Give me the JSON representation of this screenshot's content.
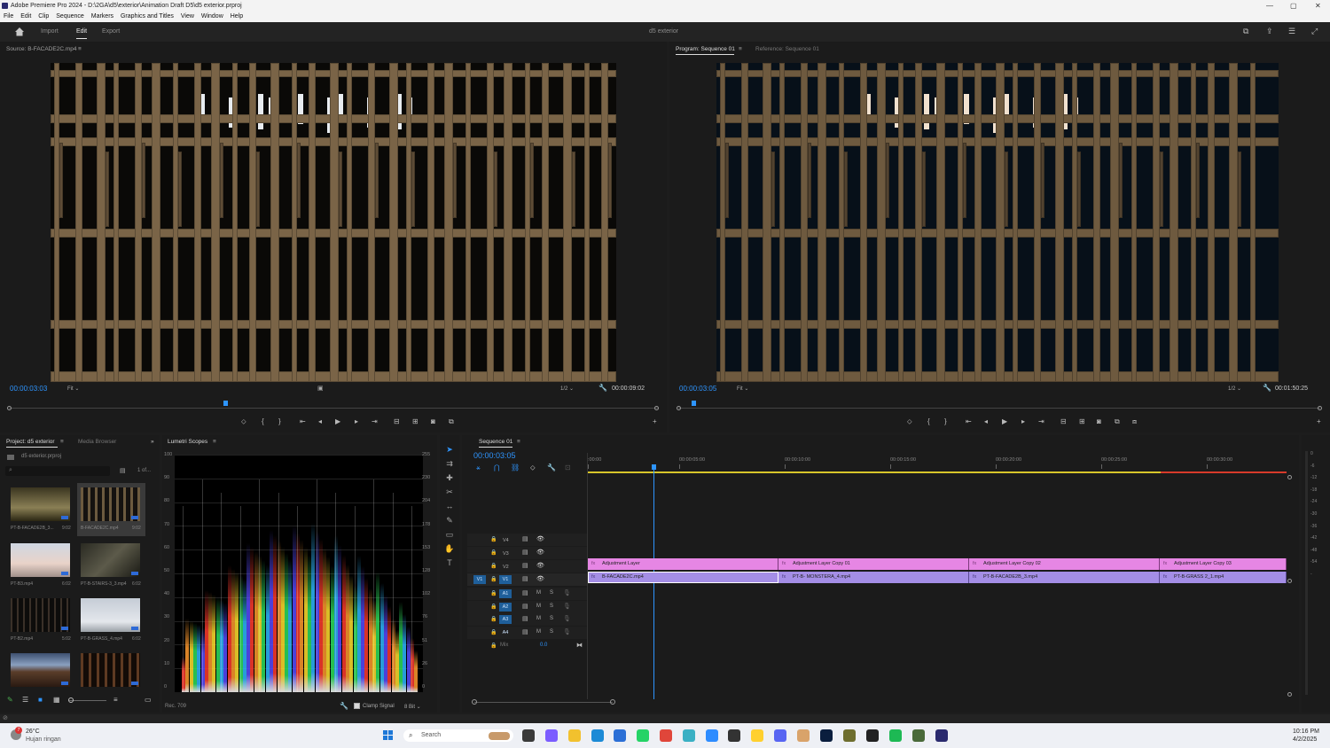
{
  "titlebar": {
    "title": "Adobe Premiere Pro 2024 - D:\\2GA\\d5\\exterior\\Animation Draft D5\\d5 exterior.prproj"
  },
  "menu": [
    "File",
    "Edit",
    "Clip",
    "Sequence",
    "Markers",
    "Graphics and Titles",
    "View",
    "Window",
    "Help"
  ],
  "workspace": {
    "tabs": [
      "Import",
      "Edit",
      "Export"
    ],
    "active": "Edit",
    "project_name": "d5 exterior"
  },
  "source_monitor": {
    "title": "Source: B-FACADE2C.mp4",
    "timecode": "00:00:03:03",
    "fit": "Fit",
    "resolution": "1/2",
    "duration": "00:00:09:02"
  },
  "program_monitor": {
    "title": "Program: Sequence 01",
    "reference_tab": "Reference: Sequence 01",
    "timecode": "00:00:03:05",
    "fit": "Fit",
    "resolution": "1/2",
    "duration": "00:01:50:25"
  },
  "project_panel": {
    "tab": "Project: d5 exterior",
    "tab2": "Media Browser",
    "file": "d5 exterior.prproj",
    "count": "1 of...",
    "items": [
      {
        "name": "PT-B-FACADE2B_3...",
        "dur": "9:02"
      },
      {
        "name": "B-FACADE2C.mp4",
        "dur": "9:02"
      },
      {
        "name": "PT-B3.mp4",
        "dur": "6:02"
      },
      {
        "name": "PT-B-STAIRS-3_3.mp4",
        "dur": "6:02"
      },
      {
        "name": "PT-B2.mp4",
        "dur": "5:02"
      },
      {
        "name": "PT-B-GRASS_4.mp4",
        "dur": "6:02"
      },
      {
        "name": "",
        "dur": ""
      },
      {
        "name": "",
        "dur": ""
      }
    ]
  },
  "lumetri": {
    "tab": "Lumetri Scopes",
    "left_scale": [
      "100",
      "90",
      "80",
      "70",
      "60",
      "50",
      "40",
      "30",
      "20",
      "10",
      "0"
    ],
    "right_scale": [
      "255",
      "230",
      "204",
      "178",
      "153",
      "128",
      "102",
      "76",
      "51",
      "26",
      "0"
    ],
    "colorspace": "Rec. 709",
    "clamp": "Clamp Signal",
    "bits": "8 Bit"
  },
  "timeline": {
    "tab": "Sequence 01",
    "timecode": "00:00:03:05",
    "ruler": [
      ":00:00",
      "00:00:05:00",
      "00:00:10:00",
      "00:00:15:00",
      "00:00:20:00",
      "00:00:25:00",
      "00:00:30:00"
    ],
    "video_tracks": [
      "V4",
      "V3",
      "V2",
      "V1"
    ],
    "audio_tracks": [
      "A1",
      "A2",
      "A3",
      "A4"
    ],
    "mix_label": "Mix",
    "mix_value": "0.0",
    "track_m": "M",
    "track_s": "S",
    "source_patch": "V1",
    "adjustment_clips": [
      "Adjustment Layer",
      "Adjustment Layer Copy 01",
      "Adjustment Layer Copy 02",
      "Adjustment Layer Copy 03"
    ],
    "video_clips": [
      "B-FACADE2C.mp4",
      "PT-B- MONSTERA_4.mp4",
      "PT-B-FACADE2B_3.mp4",
      "PT-B-GRASS 2_1.mp4"
    ]
  },
  "audio_meter": {
    "scale": [
      "0",
      "-6",
      "-12",
      "-18",
      "-24",
      "-30",
      "-36",
      "-42",
      "-48",
      "-54",
      "-"
    ]
  },
  "taskbar": {
    "weather_temp": "26°C",
    "weather_desc": "Hujan ringan",
    "weather_badge": "7",
    "search": "Search",
    "time": "10:16 PM",
    "date": "4/2/2025"
  },
  "colors": {
    "accent": "#2e95ff",
    "adjustment": "#e686e4",
    "video_clip": "#a48ee6",
    "render_bar_yellow": "#d7c62a",
    "render_bar_red": "#d73a2a"
  }
}
